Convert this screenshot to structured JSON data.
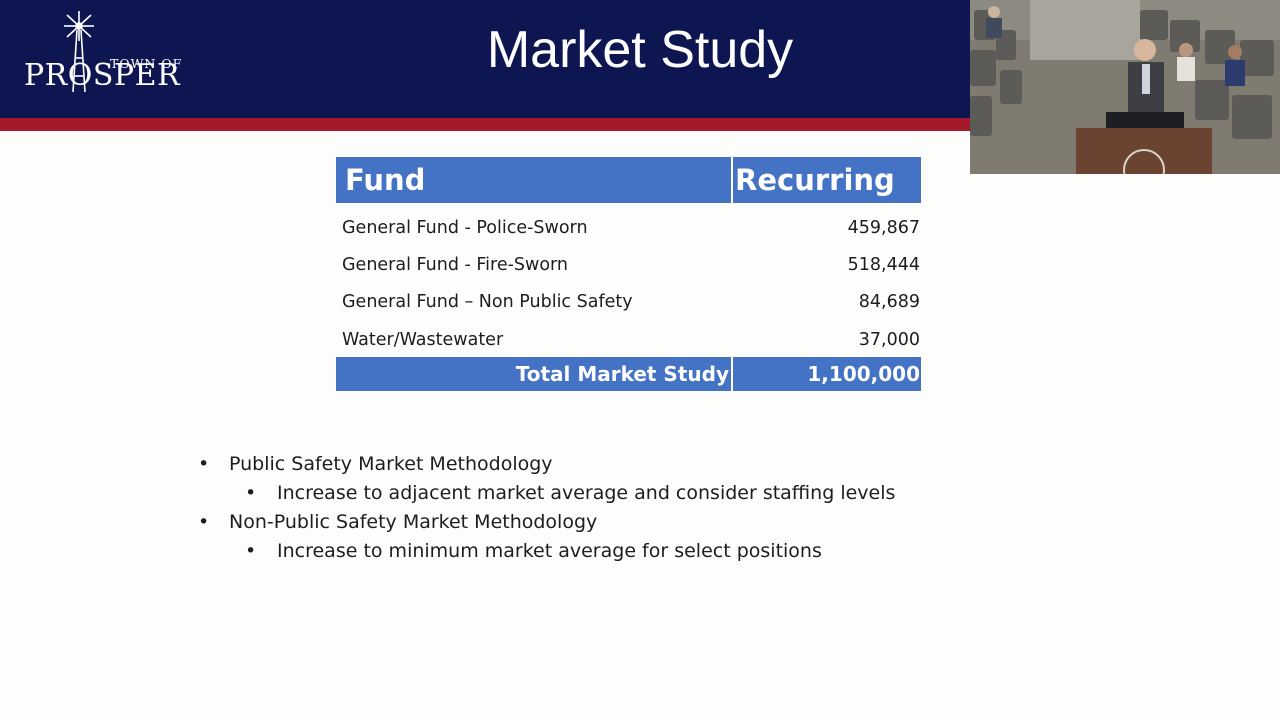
{
  "logo": {
    "town_of": "TOWN OF",
    "name": "PROSPER"
  },
  "slide": {
    "title": "Market Study"
  },
  "table": {
    "headers": {
      "fund": "Fund",
      "recurring": "Recurring"
    },
    "rows": [
      {
        "fund": "General Fund - Police-Sworn",
        "amount": "459,867"
      },
      {
        "fund": "General Fund - Fire-Sworn",
        "amount": "518,444"
      },
      {
        "fund": "General Fund – Non Public Safety",
        "amount": "84,689"
      },
      {
        "fund": "Water/Wastewater",
        "amount": "37,000"
      }
    ],
    "total": {
      "label": "Total Market Study",
      "amount": "1,100,000"
    }
  },
  "bullets": [
    {
      "text": "Public Safety Market Methodology",
      "sub": "Increase to adjacent market average and consider staffing levels"
    },
    {
      "text": "Non-Public Safety Market Methodology",
      "sub": "Increase to minimum market average for select positions"
    }
  ],
  "bullet_glyph": "•",
  "colors": {
    "header_navy": "#0e1652",
    "header_red": "#a51a2a",
    "table_blue": "#4472c4"
  }
}
